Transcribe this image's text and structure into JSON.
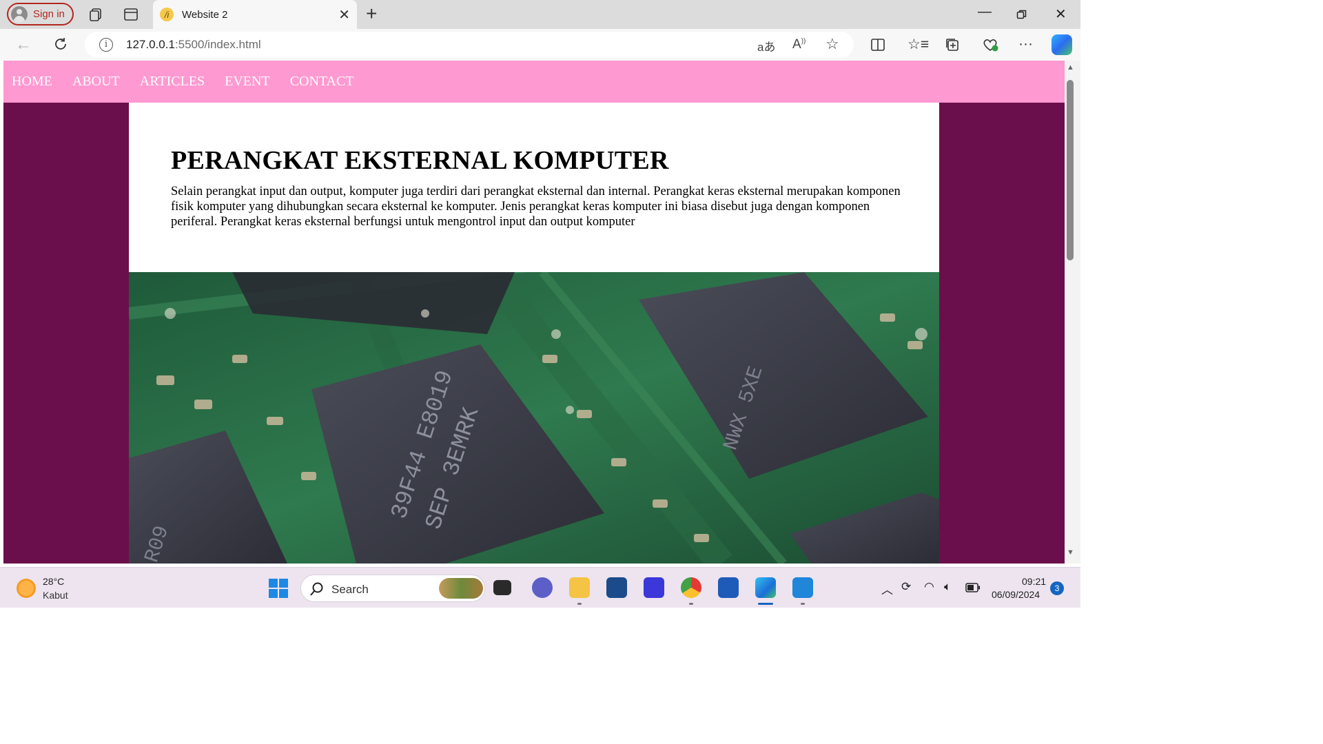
{
  "browser": {
    "signin_label": "Sign in",
    "tab_title": "Website 2",
    "url_host": "127.0.0.1",
    "url_rest": ":5500/index.html"
  },
  "page": {
    "nav": [
      "HOME",
      "ABOUT",
      "ARTICLES",
      "EVENT",
      "CONTACT"
    ],
    "heading": "PERANGKAT EKSTERNAL KOMPUTER",
    "paragraph": "Selain perangkat input dan output, komputer juga terdiri dari perangkat eksternal dan internal. Perangkat keras eksternal merupakan komponen fisik komputer yang dihubungkan secara eksternal ke komputer. Jenis perangkat keras komputer ini biasa disebut juga dengan komponen periferal. Perangkat keras eksternal berfungsi untuk mengontrol input dan output komputer",
    "image_alt": "circuit-board-photo"
  },
  "colors": {
    "nav_bg": "#ff99d1",
    "page_bg": "#6b0f4c",
    "article_bg": "#ffffff"
  },
  "taskbar": {
    "weather_temp": "28°C",
    "weather_desc": "Kabut",
    "search_placeholder": "Search",
    "time": "09:21",
    "date": "06/09/2024",
    "notification_count": "3"
  }
}
